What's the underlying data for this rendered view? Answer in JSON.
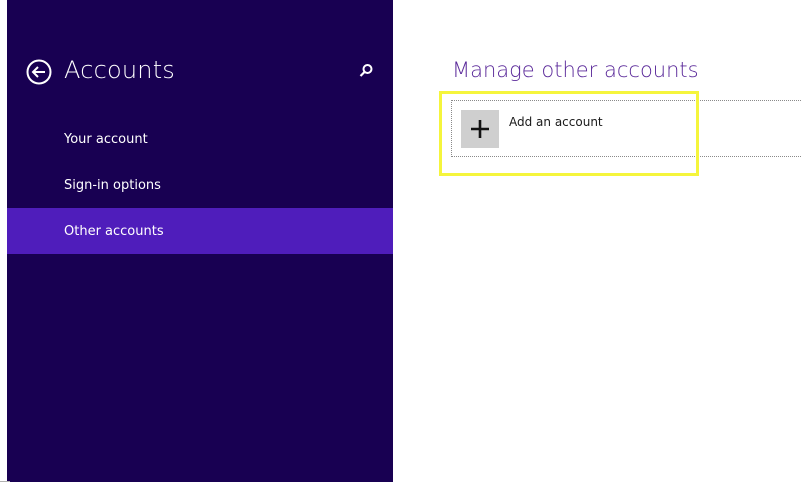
{
  "sidebar": {
    "title": "Accounts",
    "items": [
      {
        "label": "Your account"
      },
      {
        "label": "Sign-in options"
      },
      {
        "label": "Other accounts"
      }
    ],
    "selected_index": 2
  },
  "content": {
    "title": "Manage other accounts",
    "add_account_label": "Add an account"
  },
  "colors": {
    "sidebar_bg": "#180052",
    "selected_bg": "#4f1dbb",
    "title_accent": "#5b2a9a",
    "highlight": "#f5f53c"
  },
  "icons": {
    "back": "back-arrow-icon",
    "search": "search-icon",
    "add": "plus-icon"
  }
}
